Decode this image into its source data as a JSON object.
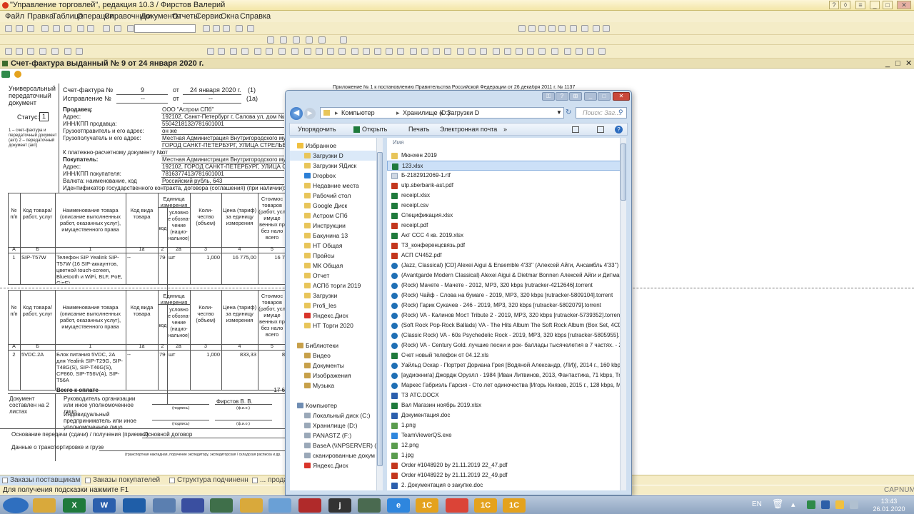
{
  "window": {
    "title": "\"Управление торговлей\", редакция 10.3 / Фирстов Валерий"
  },
  "menu": [
    "Файл",
    "Правка",
    "Таблица",
    "Операции",
    "Справочники",
    "Документы",
    "Отчеты",
    "Сервис",
    "Окна",
    "Справка"
  ],
  "document": {
    "title": "Счет-фактура выданный № 9 от 24 января 2020 г.",
    "top_note": "Приложение № 1 к постановлению Правительства Российской Федерации от 26 декабря 2011 г. № 1137",
    "upd_lines": [
      "Универсальный",
      "передаточный",
      "документ"
    ],
    "status_label": "Статус:",
    "status_value": "1",
    "status_note": "1 – счет-фактура и передаточный документ (акт) 2 – передаточный документ (акт)",
    "sf_label": "Счет-фактура №",
    "sf_num": "9",
    "ot": "от",
    "sf_date": "24 января 2020 г.",
    "n1": "(1)",
    "fix_label": "Исправление №",
    "fix_num": "--",
    "fix_date": "--",
    "n1a": "(1а)",
    "seller_label": "Продавец:",
    "seller": "ООО \"Астром СПб\"",
    "addr_label": "Адрес:",
    "seller_addr": "192102, Санкт-Петербург г, Салова ул, дом № 53",
    "inn_label": "ИНН/КПП продавца:",
    "seller_inn": "5504218132/781601001",
    "shipper_label": "Грузоотправитель и его адрес:",
    "shipper": "он же",
    "consignee_label": "Грузополучатель и его адрес:",
    "consignee": "Местная Администрация Внутригородского муниц",
    "consignee2": "ГОРОД САНКТ-ПЕТЕРБУРГ, УЛИЦА СТРЕЛЬБИЩЕН",
    "payment_label": "К платежно-расчетному документу №",
    "payment": "от",
    "buyer_label": "Покупатель:",
    "buyer": "Местная Администрация Внутригородского муниц",
    "buyer_addr": "192102, ГОРОД САНКТ-ПЕТЕРБУРГ, УЛИЦА СТРЕЛ",
    "buyer_inn_label": "ИНН/КПП покупателя:",
    "buyer_inn": "7816377413/781601001",
    "currency_label": "Валюта: наименование, код",
    "currency": "Российский рубль, 643",
    "contract_label": "Идентификатор государственного контракта, договора (соглашения) (при наличии):",
    "headers": {
      "num": "№ п/п",
      "code": "Код товара/ работ, услуг",
      "name": "Наименование товара (описание выполненных работ, оказанных услуг), имущественного права",
      "kind": "Код вида товара",
      "unit": "Единица измерения",
      "unit_code": "код",
      "unit_name": "условно е обозна-чение (нацио-нальное)",
      "qty": "Коли-чество (объем)",
      "price": "Цена (тариф) за единицу измерения",
      "cost": "Стоимос товаров (работ, усл имуще венных пр без нало всего"
    },
    "col_nums": [
      "А",
      "Б",
      "1",
      "1а",
      "2",
      "2а",
      "3",
      "4",
      "5"
    ],
    "rows": [
      {
        "n": "1",
        "code": "SIP-T57W",
        "name": "Телефон SIP Yealink SIP-T57W (16 SIP-аккаунтов, цветной touch-screen, Bluetooth и WiFi, BLF, PoE, GigE)",
        "kind": "--",
        "ucode": "796",
        "uname": "шт",
        "qty": "1,000",
        "price": "16 775,00",
        "cost": "16 7"
      },
      {
        "n": "2",
        "code": "5VDC.2A",
        "name": "Блок питания 5VDC, 2A для Yealink SIP-T29G, SIP-T48G(S), SIP-T46G(S), CP860, SIP-T56V(A), SIP-T56A",
        "kind": "--",
        "ucode": "796",
        "uname": "шт",
        "qty": "1,000",
        "price": "833,33",
        "cost": "8"
      }
    ],
    "total_label": "Всего к оплате",
    "total_value": "17 6",
    "doc_made": "Документ составлен на 2 листах",
    "head_org": "Руководитель организации или иное уполномоченное лицо",
    "signer": "Фирстов В. В.",
    "sig_caption": "(подпись)",
    "fio_caption": "(ф.и.о.)",
    "ip_label": "Индивидуальный предприниматель или иное уполномоченное лицо",
    "basis_label": "Основание передачи (сдачи) / получения (приемки)",
    "basis": "Основной договор",
    "transport_label": "Данные о транспортировке и грузе",
    "transport_note": "(транспортная накладная, поручение экспедитору, экспедиторская / складская расписка и др."
  },
  "explorer": {
    "breadcrumb": [
      "Компьютер",
      "Хранилище (D:)",
      "Загрузки D"
    ],
    "search_placeholder": "Поиск: Заг...",
    "toolbar": [
      "Упорядочить",
      "Открыть",
      "Печать",
      "Электронная почта",
      "»"
    ],
    "column_name": "Имя",
    "nav": [
      {
        "label": "Избранное",
        "type": "star",
        "indent": 0
      },
      {
        "label": "Загрузки D",
        "type": "folder",
        "indent": 1,
        "selected": true
      },
      {
        "label": "Загрузки ЯДиск",
        "type": "folder",
        "indent": 1
      },
      {
        "label": "Dropbox",
        "type": "dropbox",
        "indent": 1
      },
      {
        "label": "Недавние места",
        "type": "folder",
        "indent": 1
      },
      {
        "label": "Рабочий стол",
        "type": "folder",
        "indent": 1
      },
      {
        "label": "Google Диск",
        "type": "folder",
        "indent": 1
      },
      {
        "label": "Астром СПб",
        "type": "folder",
        "indent": 1
      },
      {
        "label": "Инструкции",
        "type": "folder",
        "indent": 1
      },
      {
        "label": "Бакунина 13",
        "type": "folder",
        "indent": 1
      },
      {
        "label": "НТ Общая",
        "type": "folder",
        "indent": 1
      },
      {
        "label": "Прайсы",
        "type": "folder",
        "indent": 1
      },
      {
        "label": "МК Общая",
        "type": "folder",
        "indent": 1
      },
      {
        "label": "Отчет",
        "type": "folder",
        "indent": 1
      },
      {
        "label": "АСПб торги 2019",
        "type": "folder",
        "indent": 1
      },
      {
        "label": "Загрузки",
        "type": "folder",
        "indent": 1
      },
      {
        "label": "Profi_les",
        "type": "folder",
        "indent": 1
      },
      {
        "label": "Яндекс.Диск",
        "type": "yandex",
        "indent": 1
      },
      {
        "label": "НТ Торги 2020",
        "type": "folder",
        "indent": 1
      },
      {
        "label": "",
        "type": "gap",
        "indent": 0
      },
      {
        "label": "Библиотеки",
        "type": "lib",
        "indent": 0
      },
      {
        "label": "Видео",
        "type": "lib",
        "indent": 1
      },
      {
        "label": "Документы",
        "type": "lib",
        "indent": 1
      },
      {
        "label": "Изображения",
        "type": "lib",
        "indent": 1
      },
      {
        "label": "Музыка",
        "type": "lib",
        "indent": 1
      },
      {
        "label": "",
        "type": "gap",
        "indent": 0
      },
      {
        "label": "Компьютер",
        "type": "pc",
        "indent": 0
      },
      {
        "label": "Локальный диск (C:)",
        "type": "drive",
        "indent": 1
      },
      {
        "label": "Хранилище (D:)",
        "type": "drive",
        "indent": 1
      },
      {
        "label": "PANASTZ (F:)",
        "type": "drive",
        "indent": 1
      },
      {
        "label": "BaseA (\\\\NPSERVER) (Y:)",
        "type": "drive",
        "indent": 1
      },
      {
        "label": "сканированные докум",
        "type": "drive",
        "indent": 1
      },
      {
        "label": "Яндекс.Диск",
        "type": "yandex",
        "indent": 1
      }
    ],
    "files": [
      {
        "name": "Мюнхен 2019",
        "type": "folder"
      },
      {
        "name": "123.xlsx",
        "type": "xls",
        "selected": true
      },
      {
        "name": "Б-2182912069-1.rtf",
        "type": "gen"
      },
      {
        "name": "utp.sberbank-ast.pdf",
        "type": "pdf"
      },
      {
        "name": "receipt.xlsx",
        "type": "xls"
      },
      {
        "name": "receipt.csv",
        "type": "xls"
      },
      {
        "name": "Спецификация.xlsx",
        "type": "xls"
      },
      {
        "name": "receipt.pdf",
        "type": "pdf"
      },
      {
        "name": "Акт ССС 4 кв. 2019.xlsx",
        "type": "xls"
      },
      {
        "name": "ТЗ_конференцсвязь.pdf",
        "type": "pdf"
      },
      {
        "name": "АСП СЧ452.pdf",
        "type": "pdf"
      },
      {
        "name": "(Jazz, Classical) [CD] Alexei Aigui & Ensemble 4'33'' (Алексей Айги, Ансамбль 4'33'') - ",
        "type": "mp"
      },
      {
        "name": "(Avantgarde Modern Classical) Alexei Aigui & Dietmar Bonnen Алексей Айги и Дитмар",
        "type": "mp"
      },
      {
        "name": "(Rock) Мачете - Мачете - 2012, MP3, 320 kbps [rutracker-4212646].torrent",
        "type": "mp"
      },
      {
        "name": "(Rock) Чайф - Слова на бумаге - 2019, MP3, 320 kbps [rutracker-5809104].torrent",
        "type": "mp"
      },
      {
        "name": "(Rock) Гарик Сукачев - 246 - 2019, MP3, 320 kbps [rutracker-5802079].torrent",
        "type": "mp"
      },
      {
        "name": "(Rock) VA - Калинов Мост Tribute 2 - 2019, MP3, 320 kbps [rutracker-5739352].torrent",
        "type": "mp"
      },
      {
        "name": "(Soft Rock Pop-Rock Ballads) VA - The Hits Album The Soft Rock Album (Box Set, 4CD)",
        "type": "mp"
      },
      {
        "name": "(Classic Rock) VA - 60s Psychedelic Rock - 2019, MP3, 320 kbps [rutracker-5805955].tor",
        "type": "mp"
      },
      {
        "name": "(Rock) VA - Century Gold. лучшие песни и рок- баллады тысячелетия в 7 частях. - 200",
        "type": "mp"
      },
      {
        "name": "Счет новый телефон от 04.12.xls",
        "type": "xls"
      },
      {
        "name": "Уайльд Оскар - Портрет Дориана Грея [Водяной Александр, (ЛИ)], 2014 г., 160 kbps,",
        "type": "mp"
      },
      {
        "name": "[аудиокнига] Джордж Оруэлл - 1984 [Иван Литвинов, 2013, Фантастика, 71 kbps, Tru",
        "type": "mp"
      },
      {
        "name": "Маркес Габриэль Гарсия - Сто лет одиночества [Игорь Князев, 2015 г., 128 kbps, MP",
        "type": "mp"
      },
      {
        "name": "ТЗ АТС.DOCX",
        "type": "doc"
      },
      {
        "name": "Вал Магазин ноябрь 2019.xlsx",
        "type": "xls"
      },
      {
        "name": "Документация.doc",
        "type": "doc"
      },
      {
        "name": "1.png",
        "type": "img"
      },
      {
        "name": "TeamViewerQS.exe",
        "type": "exe"
      },
      {
        "name": "12.png",
        "type": "img"
      },
      {
        "name": "1.jpg",
        "type": "img"
      },
      {
        "name": "Order #1048920 by 21.11.2019 22_47.pdf",
        "type": "pdf"
      },
      {
        "name": "Order #1048922 by 21.11.2019 22_49.pdf",
        "type": "pdf"
      },
      {
        "name": "2. Документация о закупке.doc",
        "type": "doc"
      }
    ]
  },
  "status_tabs": [
    "Заказы поставщикам",
    "Заказы покупателей",
    "Структура подчиненности д...",
    "... продаж"
  ],
  "hint": "Для получения подсказки нажмите F1",
  "indicators": {
    "cap": "CAP",
    "num": "NUM"
  },
  "tray": {
    "lang": "EN",
    "time": "13:43",
    "date": "26.01.2020"
  },
  "taskbar": [
    {
      "label": "",
      "name": "start-button",
      "color": "#2f6fbf"
    },
    {
      "label": "",
      "name": "taskbar-explorer",
      "color": "#d9a93b"
    },
    {
      "label": "X",
      "name": "taskbar-excel",
      "color": "#1f7a3c"
    },
    {
      "label": "W",
      "name": "taskbar-word",
      "color": "#2b5fad"
    },
    {
      "label": "",
      "name": "taskbar-outlook",
      "color": "#1f5ea8"
    },
    {
      "label": "",
      "name": "taskbar-remote",
      "color": "#5b7fb0"
    },
    {
      "label": "",
      "name": "taskbar-save",
      "color": "#3a4fa0"
    },
    {
      "label": "",
      "name": "taskbar-media",
      "color": "#3f6f4a"
    },
    {
      "label": "",
      "name": "taskbar-chrome1",
      "color": "#d9a93b"
    },
    {
      "label": "",
      "name": "taskbar-notes",
      "color": "#6aa0d6"
    },
    {
      "label": "",
      "name": "taskbar-acrobat",
      "color": "#b02a2a"
    },
    {
      "label": "j",
      "name": "taskbar-j",
      "color": "#333333"
    },
    {
      "label": "",
      "name": "taskbar-calc",
      "color": "#4a6a50"
    },
    {
      "label": "e",
      "name": "taskbar-ie",
      "color": "#2e86de"
    },
    {
      "label": "1С",
      "name": "taskbar-1c-a",
      "color": "#e4a21d"
    },
    {
      "label": "",
      "name": "taskbar-chrome",
      "color": "#db4437"
    },
    {
      "label": "1С",
      "name": "taskbar-1c-b",
      "color": "#e4a21d"
    },
    {
      "label": "1С",
      "name": "taskbar-1c-c",
      "color": "#e4a21d"
    }
  ]
}
